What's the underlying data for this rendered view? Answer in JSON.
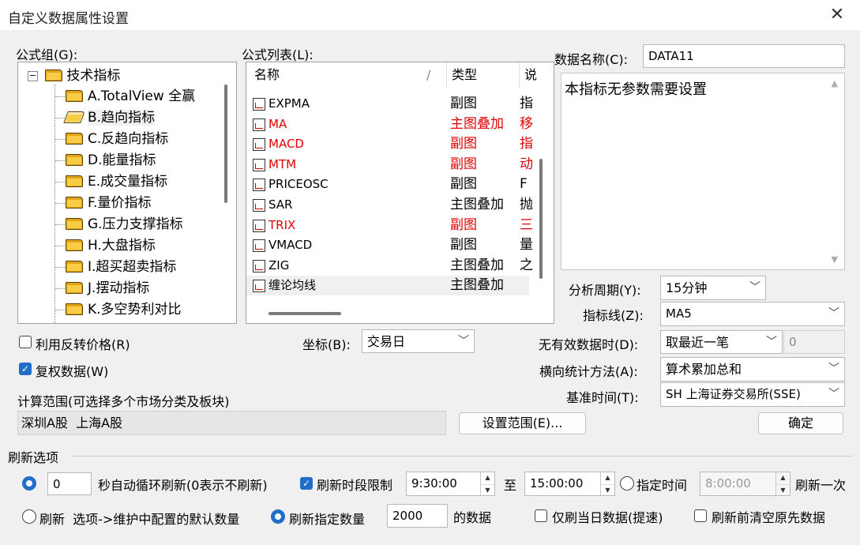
{
  "window": {
    "title": "自定义数据属性设置"
  },
  "formula_group": {
    "label": "公式组(G):",
    "root": "技术指标",
    "items": [
      "A.TotalView 全赢",
      "B.趋向指标",
      "C.反趋向指标",
      "D.能量指标",
      "E.成交量指标",
      "F.量价指标",
      "G.压力支撑指标",
      "H.大盘指标",
      "I.超买超卖指标",
      "J.摆动指标",
      "K.多空势利对比"
    ]
  },
  "formula_list": {
    "label": "公式列表(L):",
    "columns": [
      "名称",
      "类型",
      "说"
    ],
    "rows": [
      {
        "name": "EXPMA",
        "type": "副图",
        "extra": "指",
        "red": false
      },
      {
        "name": "MA",
        "type": "主图叠加",
        "extra": "移",
        "red": true
      },
      {
        "name": "MACD",
        "type": "副图",
        "extra": "指",
        "red": true
      },
      {
        "name": "MTM",
        "type": "副图",
        "extra": "动",
        "red": true
      },
      {
        "name": "PRICEOSC",
        "type": "副图",
        "extra": "F",
        "red": false
      },
      {
        "name": "SAR",
        "type": "主图叠加",
        "extra": "抛",
        "red": false
      },
      {
        "name": "TRIX",
        "type": "副图",
        "extra": "三",
        "red": true
      },
      {
        "name": "VMACD",
        "type": "副图",
        "extra": "量",
        "red": false
      },
      {
        "name": "ZIG",
        "type": "主图叠加",
        "extra": "之",
        "red": false
      },
      {
        "name": "缠论均线",
        "type": "主图叠加",
        "extra": "",
        "red": false
      }
    ]
  },
  "data_name": {
    "label": "数据名称(C):",
    "value": "DATA11"
  },
  "description": "本指标无参数需要设置",
  "period": {
    "label": "分析周期(Y):",
    "value": "15分钟"
  },
  "indicator_line": {
    "label": "指标线(Z):",
    "value": "MA5"
  },
  "invalid_data": {
    "label": "无有效数据时(D):",
    "value": "取最近一笔",
    "number": "0"
  },
  "horizontal_stat": {
    "label": "横向统计方法(A):",
    "value": "算术累加总和"
  },
  "base_time": {
    "label": "基准时间(T):",
    "value": "SH 上海证券交易所(SSE)"
  },
  "use_reverse_price": {
    "label": "利用反转价格(R)",
    "checked": false
  },
  "adjusted_data": {
    "label": "复权数据(W)",
    "checked": true
  },
  "coordinate": {
    "label": "坐标(B):",
    "value": "交易日"
  },
  "calc_range": {
    "label": "计算范围(可选择多个市场分类及板块)",
    "value": "深圳A股  上海A股",
    "set_button": "设置范围(E)..."
  },
  "ok_button": "确定",
  "refresh": {
    "section_label": "刷新选项",
    "seconds_value": "0",
    "auto_refresh_label": "秒自动循环刷新(0表示不刷新)",
    "period_limit_label": "刷新时段限制",
    "period_limit_checked": true,
    "start_time": "9:30:00",
    "to_label": "至",
    "end_time": "15:00:00",
    "specified_time_label": "指定时间",
    "specified_time_value": "8:00:00",
    "refresh_once_label": "刷新一次",
    "refresh_default_label": "刷新  选项->维护中配置的默认数量",
    "refresh_count_label": "刷新指定数量",
    "count_value": "2000",
    "data_suffix": "的数据",
    "only_today_label": "仅刷当日数据(提速)",
    "clear_before_label": "刷新前清空原先数据"
  }
}
